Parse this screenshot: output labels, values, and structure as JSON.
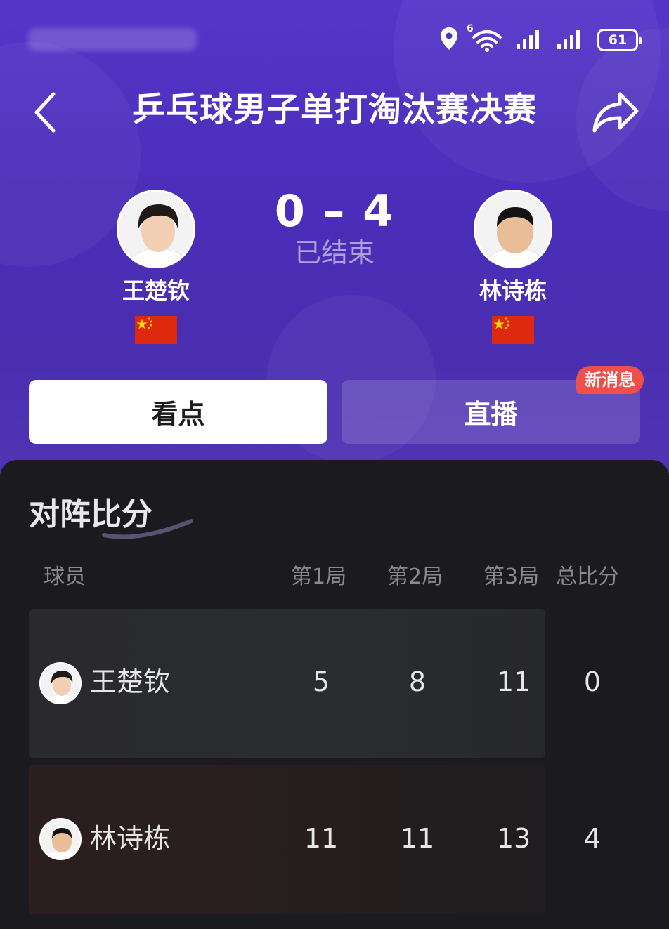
{
  "status_bar": {
    "wifi_badge": "6",
    "battery": "61",
    "icons": [
      "location-icon",
      "wifi-icon",
      "signal-icon",
      "signal-icon",
      "battery-icon"
    ]
  },
  "header": {
    "title": "乒乓球男子单打淘汰赛决赛",
    "back_icon": "chevron-left-icon",
    "share_icon": "share-icon"
  },
  "match": {
    "score": "0 – 4",
    "status": "已结束",
    "player_left": {
      "name": "王楚钦",
      "flag": "china-flag"
    },
    "player_right": {
      "name": "林诗栋",
      "flag": "china-flag"
    }
  },
  "tabs": {
    "highlights_label": "看点",
    "live_label": "直播",
    "new_badge": "新消息"
  },
  "scoreboard": {
    "title": "对阵比分",
    "headers": {
      "player": "球员",
      "set1": "第1局",
      "set2": "第2局",
      "set3": "第3局",
      "total": "总比分"
    },
    "rows": [
      {
        "name": "王楚钦",
        "set1": "5",
        "set2": "8",
        "set3": "11",
        "total": "0"
      },
      {
        "name": "林诗栋",
        "set1": "11",
        "set2": "11",
        "set3": "13",
        "total": "4"
      }
    ]
  },
  "colors": {
    "header_purple": "#4f32ba",
    "badge_red": "#f0504a",
    "panel_dark": "#1b1b1f"
  }
}
